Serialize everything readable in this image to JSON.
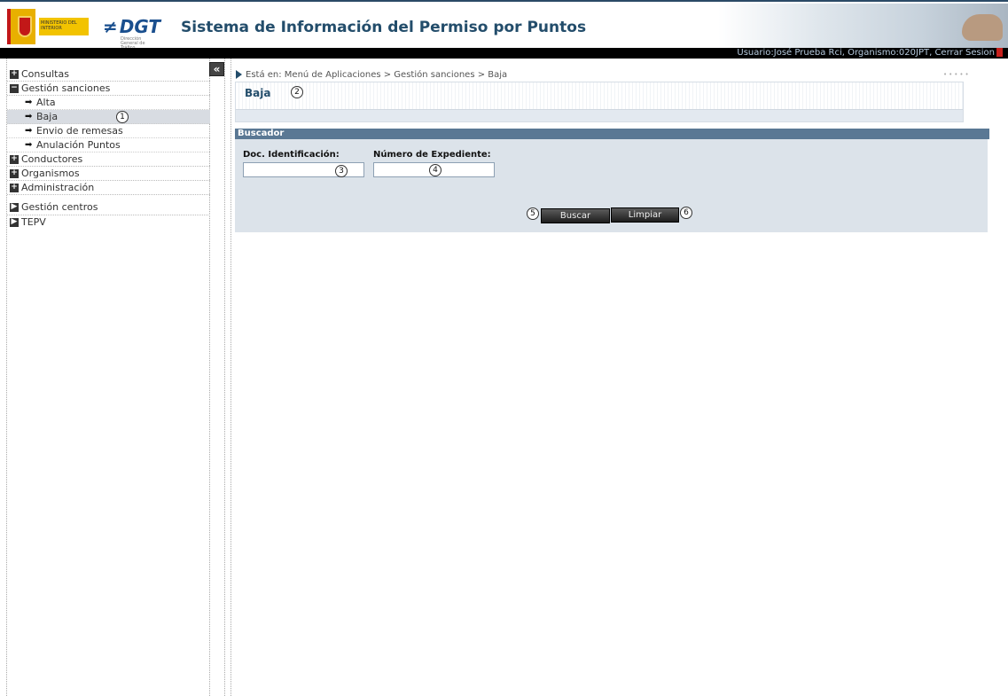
{
  "header": {
    "ministry_text": "MINISTERIO DEL INTERIOR",
    "dgt_logo": "DGT",
    "dgt_subtitle": "Dirección General de Tráfico",
    "app_title": "Sistema de Información del Permiso por Puntos"
  },
  "user_strip": {
    "text": "Usuario:José Prueba Rci, Organismo:020JPT, Cerrar Sesion"
  },
  "sidebar": {
    "collapse_label": "«",
    "items": [
      {
        "label": "Consultas",
        "toggle": "+"
      },
      {
        "label": "Gestión sanciones",
        "toggle": "−"
      },
      {
        "label": "Conductores",
        "toggle": "+"
      },
      {
        "label": "Organismos",
        "toggle": "+"
      },
      {
        "label": "Administración",
        "toggle": "+"
      },
      {
        "label": "Gestión centros",
        "toggle": "▶"
      },
      {
        "label": "TEPV",
        "toggle": "▶"
      }
    ],
    "sub_items": [
      {
        "label": "Alta"
      },
      {
        "label": "Baja"
      },
      {
        "label": "Envio de remesas"
      },
      {
        "label": "Anulación Puntos"
      }
    ],
    "arrow": "➡"
  },
  "breadcrumb": {
    "text": "Está en:  Menú de Aplicaciones  > Gestión sanciones  > Baja"
  },
  "page": {
    "title": "Baja"
  },
  "search": {
    "header": "Buscador",
    "doc_label": "Doc. Identificación:",
    "doc_value": "",
    "exp_label": "Número de Expediente:",
    "exp_value": "",
    "search_button": "Buscar",
    "clear_button": "Limpiar"
  },
  "callouts": {
    "c1": "1",
    "c2": "2",
    "c3": "3",
    "c4": "4",
    "c5": "5",
    "c6": "6"
  },
  "dots": "•••••"
}
